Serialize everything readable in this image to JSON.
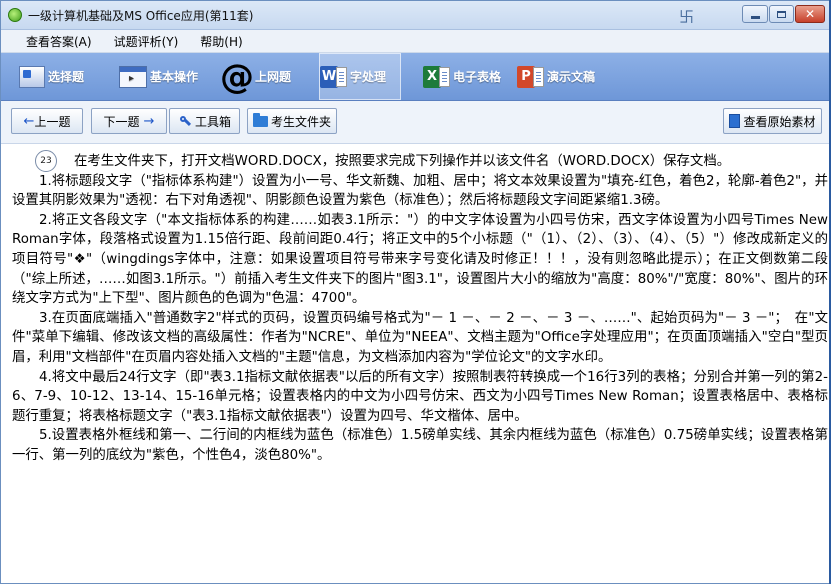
{
  "window": {
    "title": "一级计算机基础及MS Office应用(第11套)",
    "pin_glyph": "卐"
  },
  "menu": [
    {
      "label": "查看答案(A)"
    },
    {
      "label": "试题评析(Y)"
    },
    {
      "label": "帮助(H)"
    }
  ],
  "categories": [
    {
      "label": "选择题"
    },
    {
      "label": "基本操作"
    },
    {
      "label": "上网题",
      "icon_glyph": "@"
    },
    {
      "label": "字处理",
      "badge": "W"
    },
    {
      "label": "电子表格",
      "badge": "X"
    },
    {
      "label": "演示文稿",
      "badge": "P"
    }
  ],
  "toolbar": {
    "prev": "上一题",
    "prev_arrow": "←",
    "next": "下一题",
    "next_arrow": "→",
    "tools": "工具箱",
    "folder": "考生文件夹",
    "view_material": "查看原始素材"
  },
  "question": {
    "number": "23",
    "intro": "在考生文件夹下，打开文档WORD.DOCX，按照要求完成下列操作并以该文件名（WORD.DOCX）保存文档。",
    "items": [
      "1.将标题段文字（\"指标体系构建\"）设置为小一号、华文新魏、加粗、居中；将文本效果设置为\"填充-红色，着色2，轮廓-着色2\"，并设置其阴影效果为\"透视：右下对角透视\"、阴影颜色设置为紫色（标准色）；然后将标题段文字间距紧缩1.3磅。",
      "2.将正文各段文字（\"本文指标体系的构建……如表3.1所示：\"）的中文字体设置为小四号仿宋，西文字体设置为小四号Times New Roman字体，段落格式设置为1.15倍行距、段前间距0.4行；将正文中的5个小标题（\"（1）、（2）、（3）、（4）、（5）\"）修改成新定义的项目符号\"❖\"（wingdings字体中，注意：如果设置项目符号带来字号变化请及时修正！！！，没有则忽略此提示）；在正文倒数第二段（\"综上所述，……如图3.1所示。\"）前插入考生文件夹下的图片\"图3.1\"，设置图片大小的缩放为\"高度：80%\"/\"宽度：80%\"、图片的环绕文字方式为\"上下型\"、图片颜色的色调为\"色温：4700\"。",
      "3.在页面底端插入\"普通数字2\"样式的页码，设置页码编号格式为\"－ 1 －、－ 2 －、－ 3 －、……\"、起始页码为\"－ 3 －\"；　在\"文件\"菜单下编辑、修改该文档的高级属性：作者为\"NCRE\"、单位为\"NEEA\"、文档主题为\"Office字处理应用\"；在页面顶端插入\"空白\"型页眉，利用\"文档部件\"在页眉内容处插入文档的\"主题\"信息，为文档添加内容为\"学位论文\"的文字水印。",
      "4.将文中最后24行文字（即\"表3.1指标文献依据表\"以后的所有文字）按照制表符转换成一个16行3列的表格；分别合并第一列的第2-6、7-9、10-12、13-14、15-16单元格；设置表格内的中文为小四号仿宋、西文为小四号Times New Roman；设置表格居中、表格标题行重复；将表格标题文字（\"表3.1指标文献依据表\"）设置为四号、华文楷体、居中。",
      "5.设置表格外框线和第一、二行间的内框线为蓝色（标准色）1.5磅单实线、其余内框线为蓝色（标准色）0.75磅单实线；设置表格第一行、第一列的底纹为\"紫色，个性色4，淡色80%\"。"
    ]
  }
}
